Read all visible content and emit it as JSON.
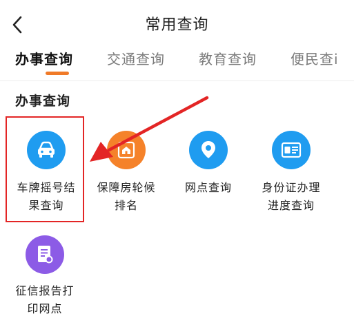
{
  "header": {
    "title": "常用查询",
    "back_icon": "chevron-left-icon"
  },
  "tabs": [
    {
      "label": "办事查询",
      "active": true
    },
    {
      "label": "交通查询",
      "active": false
    },
    {
      "label": "教育查询",
      "active": false
    },
    {
      "label": "便民查i",
      "active": false
    }
  ],
  "accent_color": "#f07a28",
  "section": {
    "title": "办事查询",
    "items": [
      {
        "line1": "车牌摇号结",
        "line2": "果查询",
        "icon": "car-icon",
        "color": "#1f9cf0"
      },
      {
        "line1": "保障房轮候",
        "line2": "排名",
        "icon": "house-icon",
        "color": "#f5822a"
      },
      {
        "line1": "网点查询",
        "line2": "",
        "icon": "location-pin-icon",
        "color": "#1f9cf0"
      },
      {
        "line1": "身份证办理",
        "line2": "进度查询",
        "icon": "id-card-icon",
        "color": "#1f9cf0"
      },
      {
        "line1": "征信报告打",
        "line2": "印网点",
        "icon": "document-icon",
        "color": "#8c5be6"
      }
    ]
  },
  "annotation": {
    "box_color": "#e32525",
    "arrow_color": "#e32525"
  }
}
